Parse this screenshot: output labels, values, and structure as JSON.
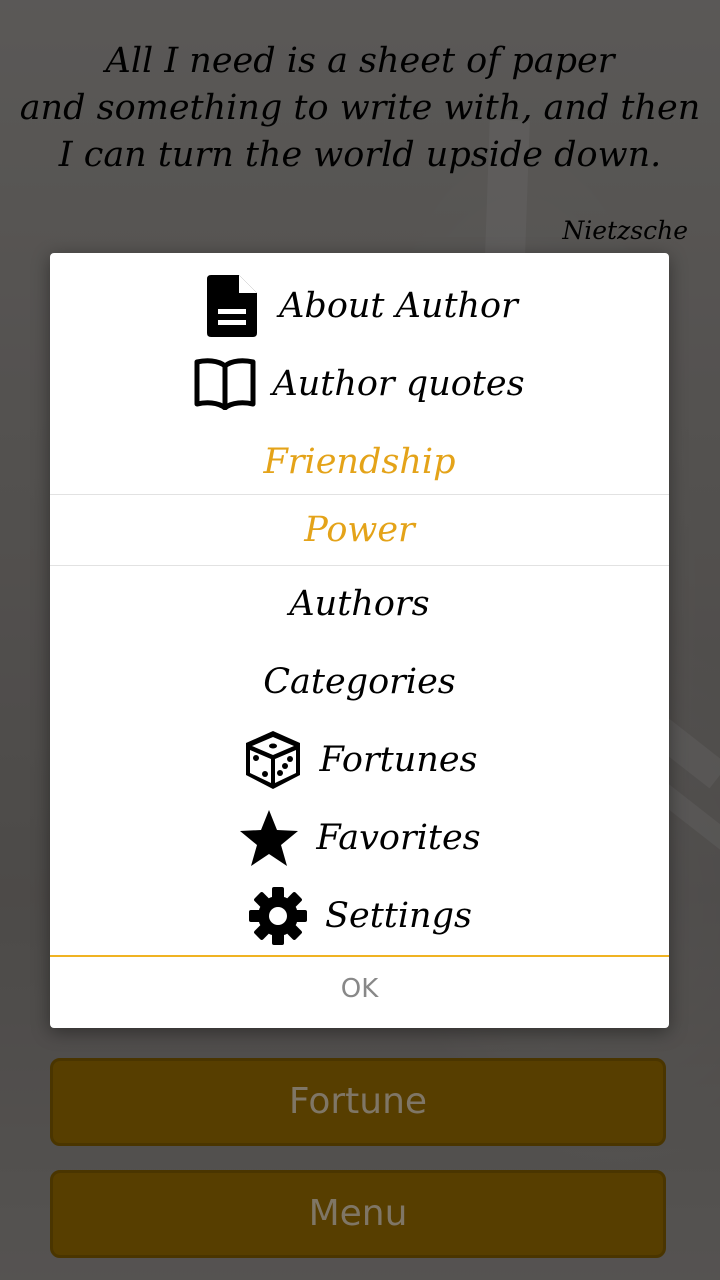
{
  "quote": {
    "lines": [
      "All I need is a sheet of paper",
      "and something to write with, and then",
      "I can turn the world upside down."
    ],
    "author": "Nietzsche"
  },
  "dialog": {
    "items": [
      {
        "label": "About Author",
        "icon": "document-icon"
      },
      {
        "label": "Author quotes",
        "icon": "book-icon"
      },
      {
        "label": "Friendship",
        "icon": null,
        "accent": true
      },
      {
        "label": "Power",
        "icon": null,
        "accent": true
      },
      {
        "label": "Authors",
        "icon": null
      },
      {
        "label": "Categories",
        "icon": null
      },
      {
        "label": "Fortunes",
        "icon": "dice-icon"
      },
      {
        "label": "Favorites",
        "icon": "star-icon"
      },
      {
        "label": "Settings",
        "icon": "gear-icon"
      }
    ],
    "ok_label": "OK"
  },
  "buttons": {
    "fortune_label": "Fortune",
    "menu_label": "Menu"
  },
  "colors": {
    "accent": "#e4a319",
    "button_bg": "#573e00",
    "divider": "#f0b323"
  }
}
